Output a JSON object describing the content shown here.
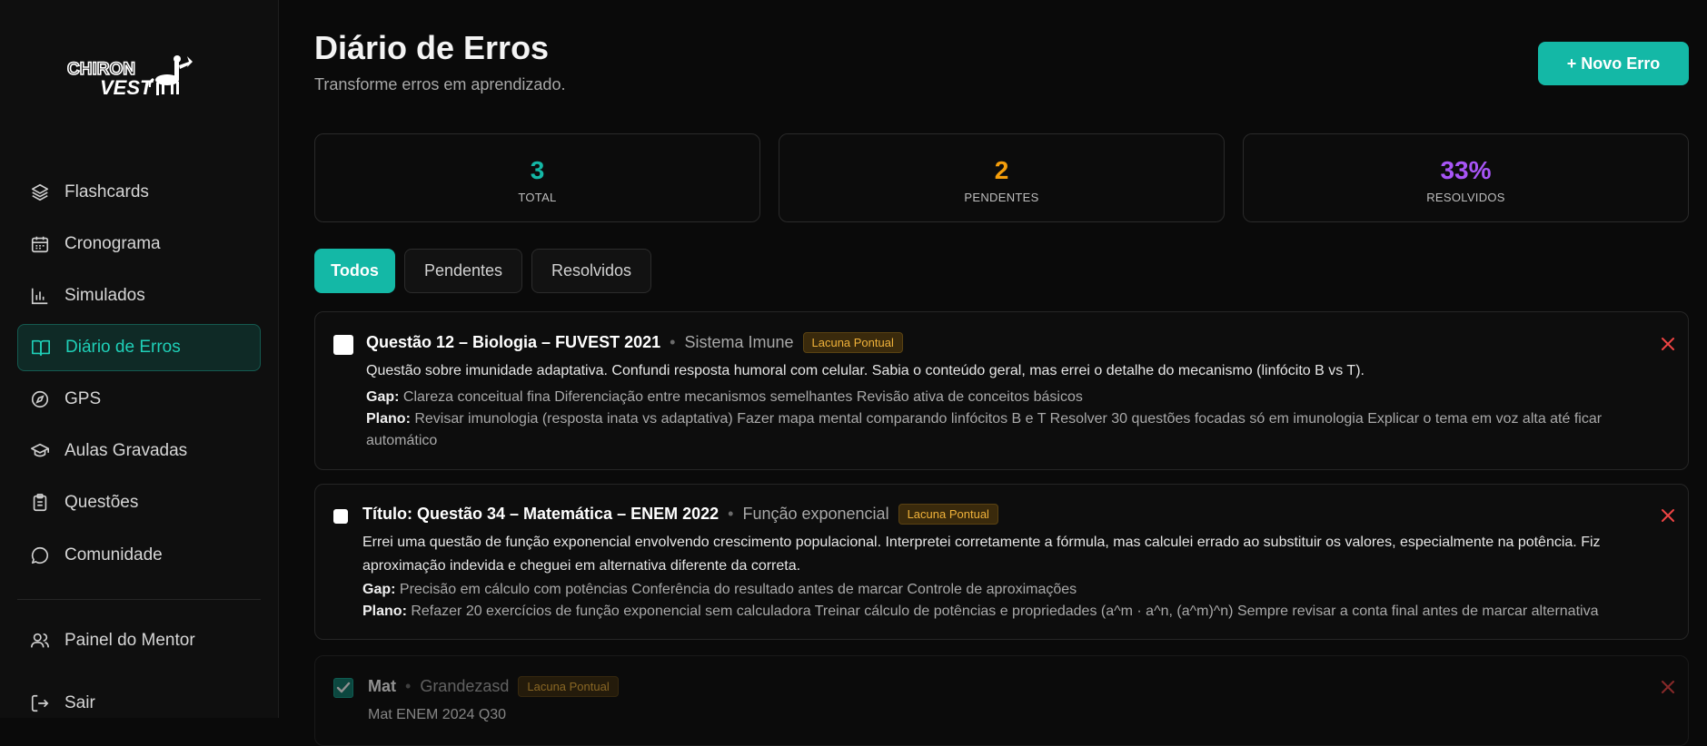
{
  "sidebar": {
    "logo_text_top": "CHIRON",
    "logo_text_bottom": "VEST",
    "items": [
      {
        "label": "Flashcards",
        "icon": "layers-icon"
      },
      {
        "label": "Cronograma",
        "icon": "calendar-icon"
      },
      {
        "label": "Simulados",
        "icon": "bar-chart-icon"
      },
      {
        "label": "Diário de Erros",
        "icon": "book-open-icon",
        "active": true
      },
      {
        "label": "GPS",
        "icon": "compass-icon"
      },
      {
        "label": "Aulas Gravadas",
        "icon": "graduation-cap-icon"
      },
      {
        "label": "Questões",
        "icon": "clipboard-icon"
      },
      {
        "label": "Comunidade",
        "icon": "chat-bubble-icon"
      }
    ],
    "footer_items": [
      {
        "label": "Painel do Mentor",
        "icon": "users-icon"
      },
      {
        "label": "Sair",
        "icon": "logout-icon"
      }
    ]
  },
  "header": {
    "title": "Diário de Erros",
    "subtitle": "Transforme erros em aprendizado.",
    "new_button": "+ Novo Erro"
  },
  "stats": [
    {
      "value": "3",
      "label": "TOTAL",
      "color": "#14b8a6"
    },
    {
      "value": "2",
      "label": "PENDENTES",
      "color": "#f59e0b"
    },
    {
      "value": "33%",
      "label": "RESOLVIDOS",
      "color": "#a855f7"
    }
  ],
  "tabs": [
    {
      "label": "Todos",
      "active": true
    },
    {
      "label": "Pendentes",
      "active": false
    },
    {
      "label": "Resolvidos",
      "active": false
    }
  ],
  "labels": {
    "gap": "Gap:",
    "plano": "Plano:"
  },
  "colors": {
    "accent": "#14b8a6",
    "danger": "#ef4444",
    "badge": "#f0b23a"
  },
  "errors": [
    {
      "title": "Questão 12 – Biologia – FUVEST 2021",
      "topic": "Sistema Imune",
      "badge": "Lacuna Pontual",
      "checked": false,
      "description": "Questão sobre imunidade adaptativa. Confundi resposta humoral com celular. Sabia o conteúdo geral, mas errei o detalhe do mecanismo (linfócito B vs T).",
      "gap": "Clareza conceitual fina Diferenciação entre mecanismos semelhantes Revisão ativa de conceitos básicos",
      "plano": "Revisar imunologia (resposta inata vs adaptativa) Fazer mapa mental comparando linfócitos B e T Resolver 30 questões focadas só em imunologia Explicar o tema em voz alta até ficar automático"
    },
    {
      "title": "Título: Questão 34 – Matemática – ENEM 2022",
      "topic": "Função exponencial",
      "badge": "Lacuna Pontual",
      "checked": false,
      "description": "Errei uma questão de função exponencial envolvendo crescimento populacional. Interpretei corretamente a fórmula, mas calculei errado ao substituir os valores, especialmente na potência. Fiz aproximação indevida e cheguei em alternativa diferente da correta.",
      "gap": "Precisão em cálculo com potências Conferência do resultado antes de marcar Controle de aproximações",
      "plano": "Refazer 20 exercícios de função exponencial sem calculadora Treinar cálculo de potências e propriedades (a^m · a^n, (a^m)^n) Sempre revisar a conta final antes de marcar alternativa"
    },
    {
      "title": "Mat",
      "topic": "Grandezasd",
      "badge": "Lacuna Pontual",
      "checked": true,
      "description": "Mat ENEM 2024 Q30"
    }
  ]
}
